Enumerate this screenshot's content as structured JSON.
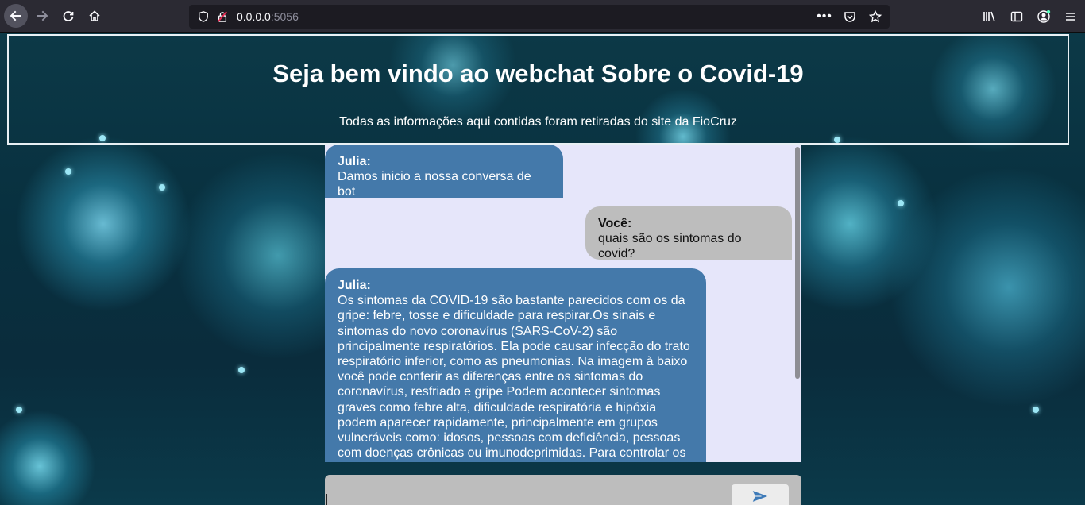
{
  "browser": {
    "url_host": "0.0.0.0",
    "url_port": ":5056"
  },
  "header": {
    "title": "Seja bem vindo ao webchat Sobre o Covid-19",
    "subtitle": "Todas as informações aqui contidas foram retiradas do site da FioCruz"
  },
  "chat": {
    "messages": [
      {
        "sender": "Julia:",
        "text": "Damos inicio a nossa conversa de bot"
      },
      {
        "sender": "Você:",
        "text": "quais são os sintomas do covid?"
      },
      {
        "sender": "Julia:",
        "text": "Os sintomas da COVID-19 são bastante parecidos com os da gripe: febre, tosse e dificuldade para respirar.Os sinais e sintomas do novo coronavírus (SARS-CoV-2) são principalmente respiratórios. Ela pode causar infecção do trato respiratório inferior, como as pneumonias. Na imagem à baixo você pode conferir as diferenças entre os sintomas do coronavírus, resfriado e gripe Podem acontecer sintomas graves como febre alta, dificuldade respiratória e hipóxia podem aparecer rapidamente, principalmente em grupos vulneráveis como: idosos, pessoas com deficiência, pessoas com doenças crônicas ou imunodeprimidas. Para controlar os"
      }
    ]
  },
  "input": {
    "value": ""
  },
  "colors": {
    "bot_bubble": "#4479aa",
    "user_bubble": "#bdbdbd",
    "chat_bg": "#e6e6fa",
    "send_icon": "#3d7ab8"
  }
}
